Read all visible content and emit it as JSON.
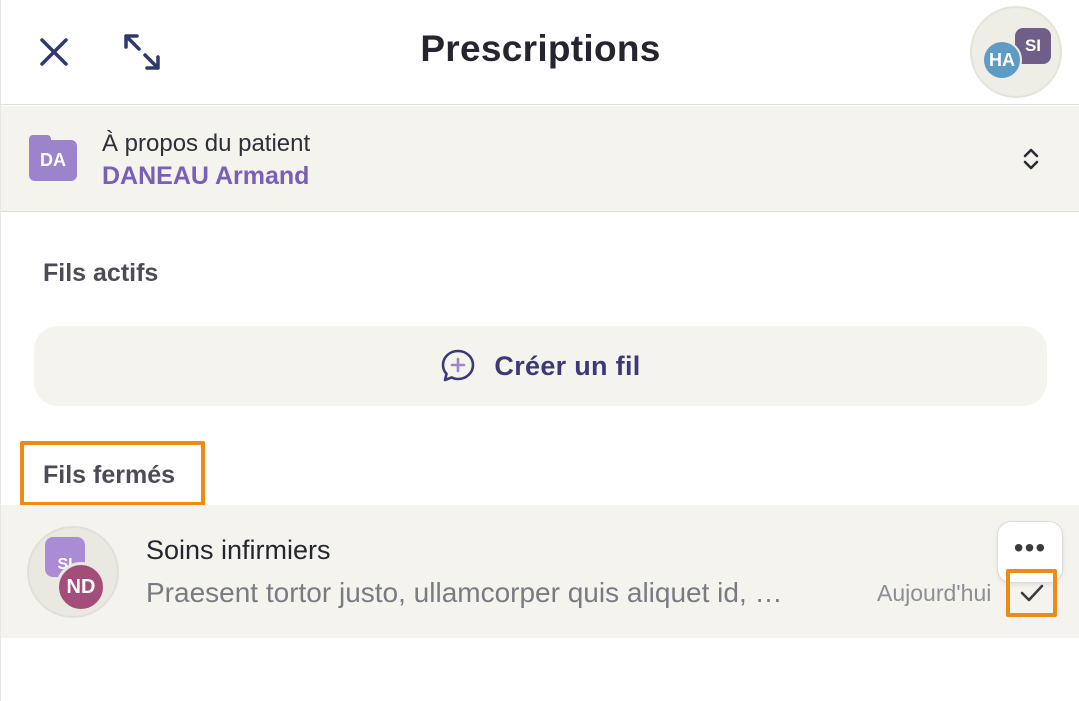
{
  "header": {
    "title": "Prescriptions",
    "close_icon": "close-icon",
    "expand_icon": "expand-arrows-icon",
    "participants": [
      {
        "initials": "SI",
        "color": "#6f5e88"
      },
      {
        "initials": "HA",
        "color": "#5f9cc5"
      }
    ]
  },
  "patient": {
    "badge_initials": "DA",
    "badge_color": "#9b84cc",
    "caption": "À propos du patient",
    "name": "DANEAU Armand",
    "toggle_icon": "chevron-up-down-icon"
  },
  "sections": {
    "active_title": "Fils actifs",
    "create_label": "Créer un fil",
    "create_icon": "add-comment-icon",
    "closed_title": "Fils fermés"
  },
  "closed_threads": [
    {
      "avatars": [
        {
          "initials": "SI",
          "color": "#a98bd6"
        },
        {
          "initials": "ND",
          "color": "#a34e78"
        }
      ],
      "title": "Soins infirmiers",
      "preview": "Praesent tortor justo, ullamcorper quis aliquet id, …",
      "date": "Aujourd'hui",
      "more_label": "•••",
      "status_icon": "checkmark-icon"
    }
  ],
  "colors": {
    "accent_purple": "#7a5fb8",
    "navy": "#3b3978",
    "highlight_orange": "#f08a14",
    "panel_bg": "#f4f3ee"
  }
}
